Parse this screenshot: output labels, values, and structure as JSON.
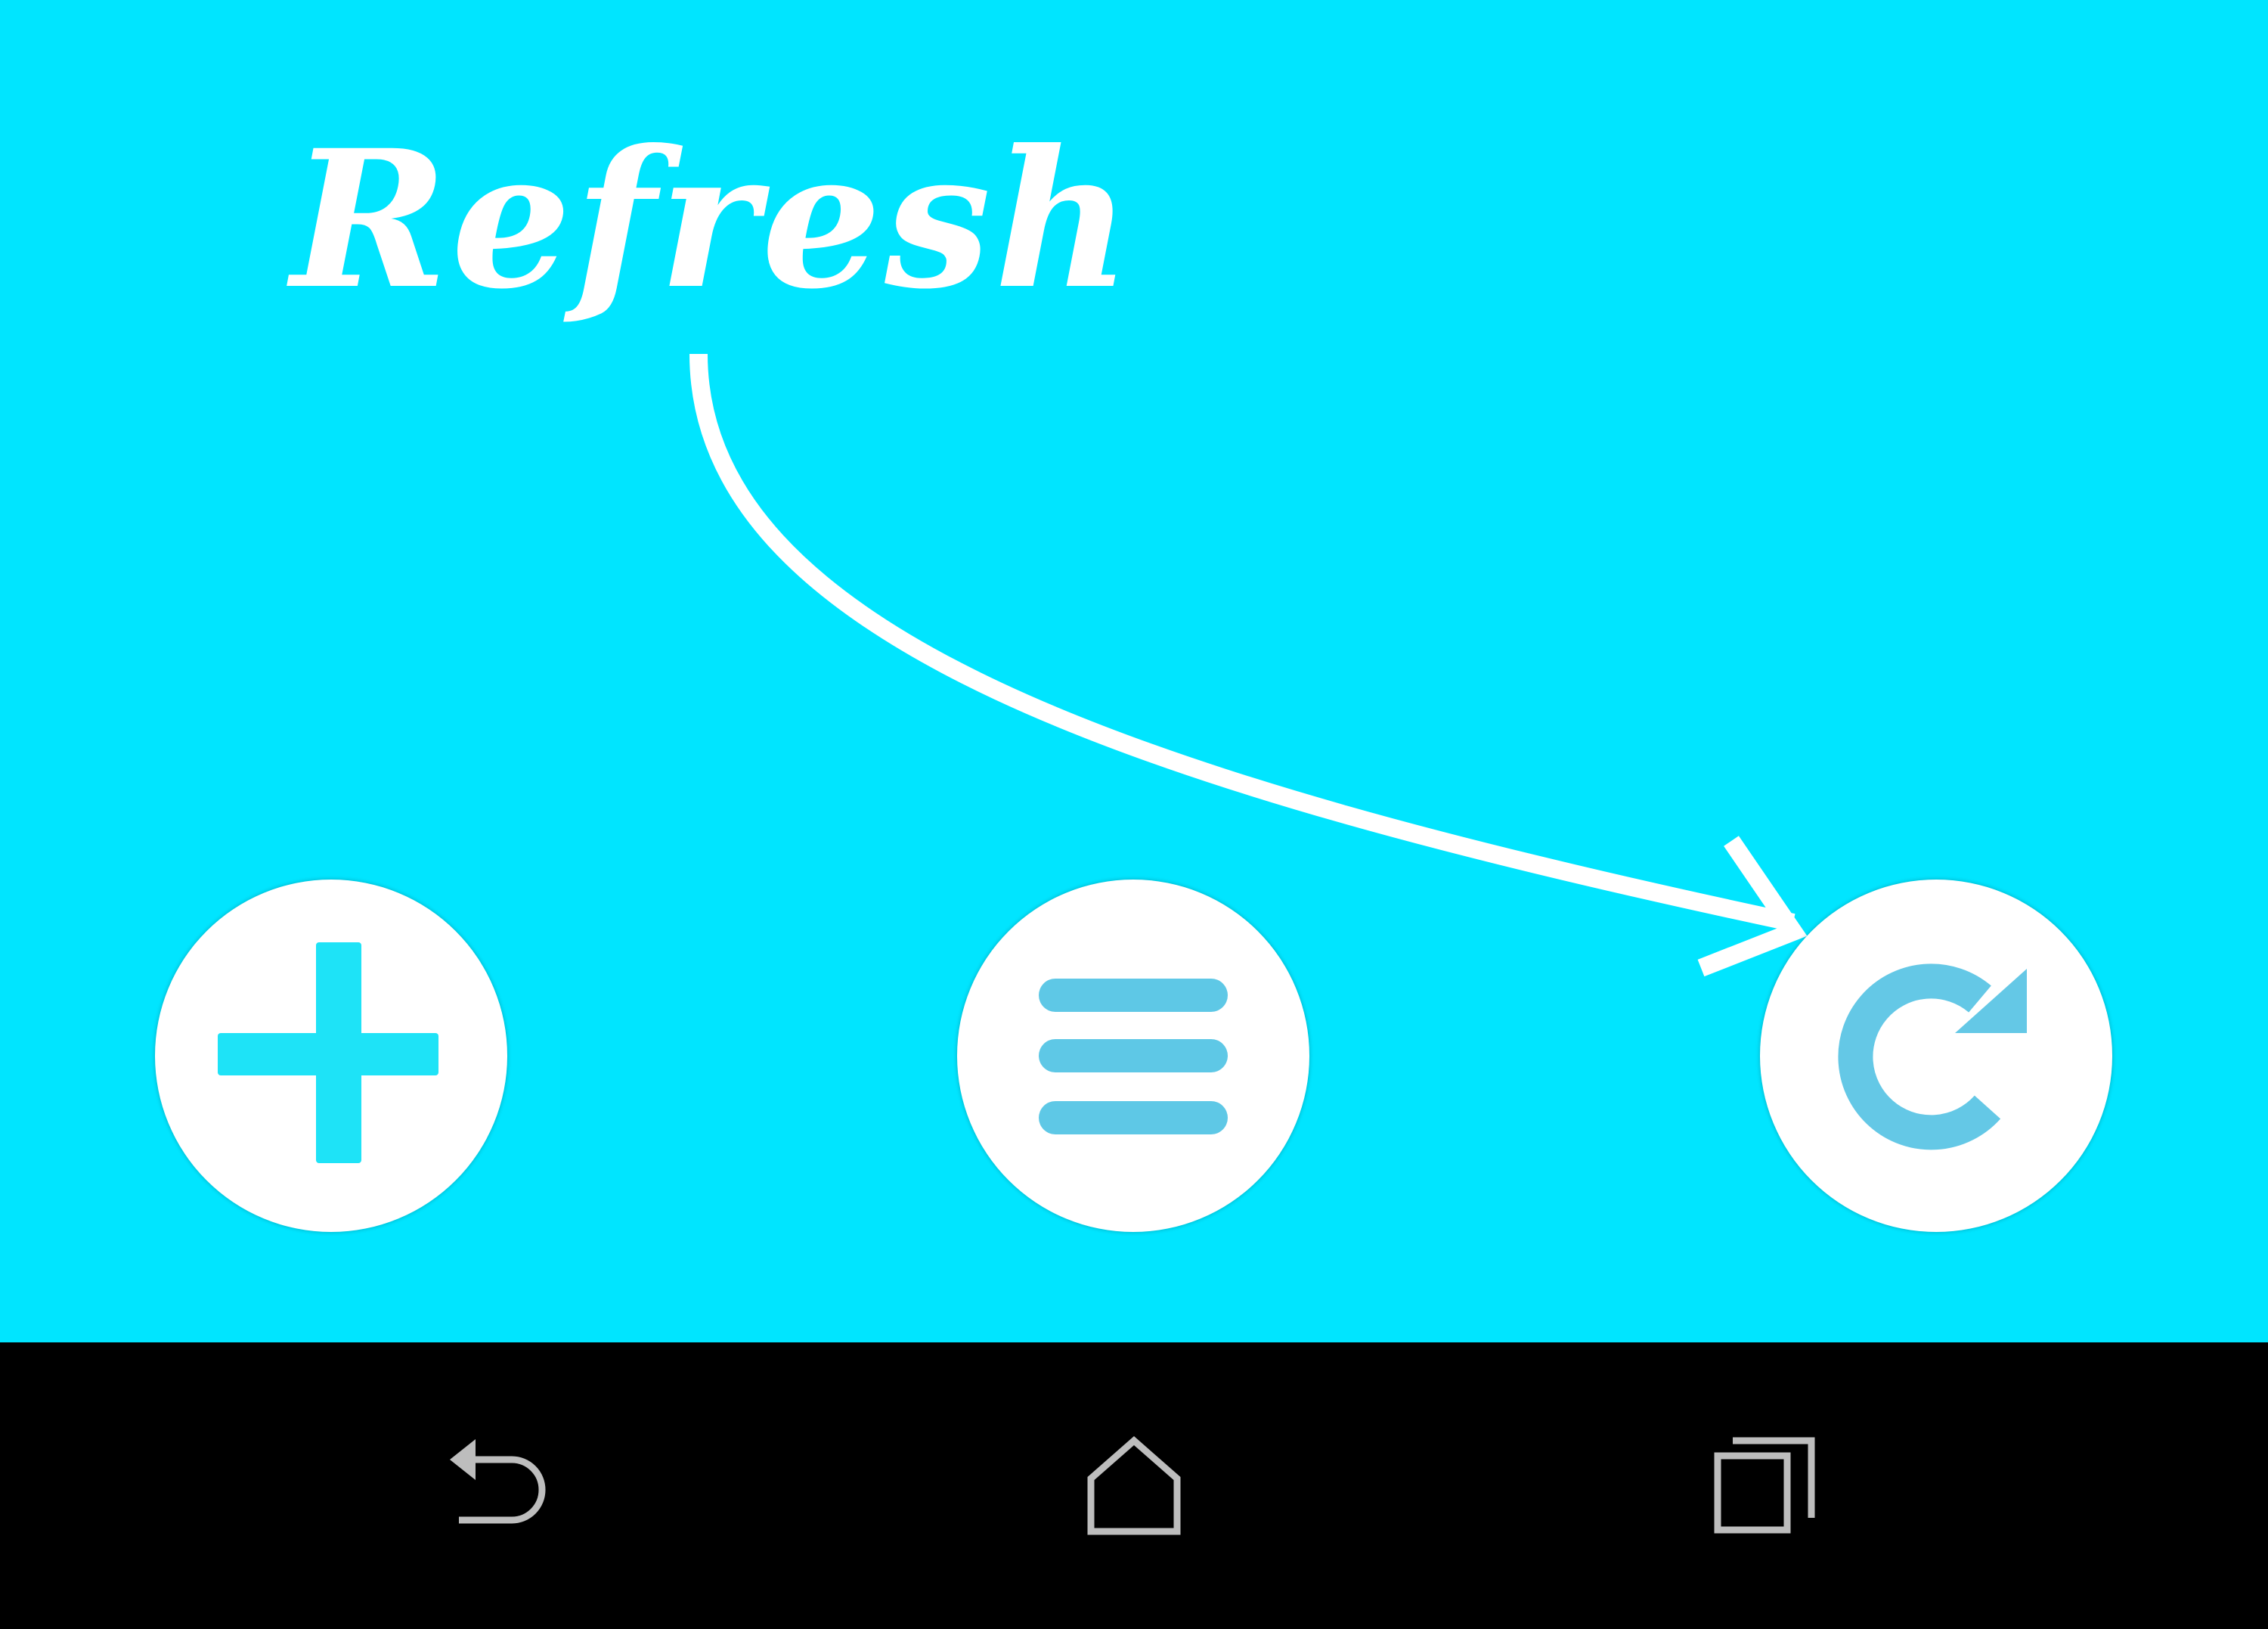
{
  "overlay": {
    "hint_text": "Refresh"
  },
  "actions": [
    {
      "name": "add",
      "icon": "plus-icon"
    },
    {
      "name": "menu",
      "icon": "hamburger-menu-icon"
    },
    {
      "name": "refresh",
      "icon": "refresh-icon"
    }
  ],
  "navbar": {
    "buttons": [
      {
        "name": "back",
        "icon": "back-icon"
      },
      {
        "name": "home",
        "icon": "home-icon"
      },
      {
        "name": "recents",
        "icon": "recent-apps-icon"
      }
    ]
  },
  "colors": {
    "background": "#00e5ff",
    "fab": "#ffffff",
    "add_icon": "#1ee3f7",
    "menu_icon": "#5ec8e6",
    "refresh_icon": "#64c8e6",
    "navbar": "#000000",
    "nav_icon": "#bdbdbd"
  }
}
